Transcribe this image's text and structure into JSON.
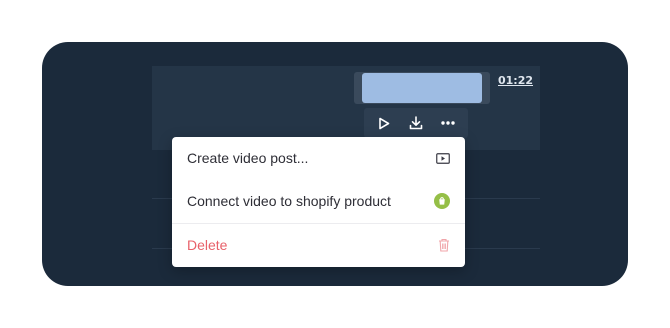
{
  "player": {
    "time": "01:22",
    "actions": [
      {
        "name": "play",
        "icon": "play-icon"
      },
      {
        "name": "download",
        "icon": "download-icon"
      },
      {
        "name": "more",
        "icon": "more-icon"
      }
    ]
  },
  "menu": {
    "items": [
      {
        "label": "Create video post...",
        "icon": "video-post-icon"
      },
      {
        "label": "Connect video to shopify product",
        "icon": "shopify-icon"
      },
      {
        "label": "Delete",
        "icon": "trash-icon"
      }
    ]
  },
  "colors": {
    "background": "#1b2a3b",
    "accent_thumb": "#9ebce3",
    "shopify_green": "#95bf47",
    "delete_red": "#e8616a"
  }
}
